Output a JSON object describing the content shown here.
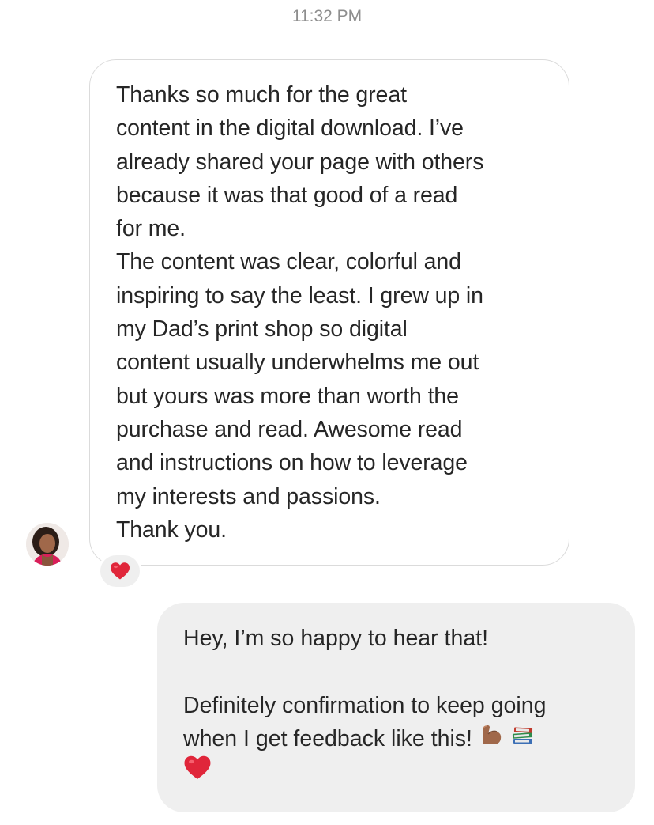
{
  "conversation": {
    "timestamp": "11:32 PM",
    "received": {
      "text": "Thanks so much for the great\ncontent in the digital download. I’ve\nalready shared your page with others\nbecause it was that good of a read\nfor me.\nThe content was clear, colorful and\ninspiring to say the least. I grew up in\nmy Dad’s print shop so digital\ncontent usually underwhelms me out\nbut yours was more than worth the\npurchase and read. Awesome read\nand instructions on how to leverage\nmy interests and passions.\nThank you.",
      "reaction_icon": "heart-emoji"
    },
    "sent": {
      "line1": "Hey, I’m so happy to hear that!",
      "line2": "Definitely confirmation to keep going",
      "line3": "when I get feedback like this!",
      "emojis": [
        "flexed-biceps-emoji",
        "books-emoji",
        "heart-emoji"
      ]
    },
    "colors": {
      "received_border": "#dbdbdb",
      "sent_background": "#efefef",
      "heart": "#e0263a",
      "timestamp": "#8e8e8e"
    }
  }
}
